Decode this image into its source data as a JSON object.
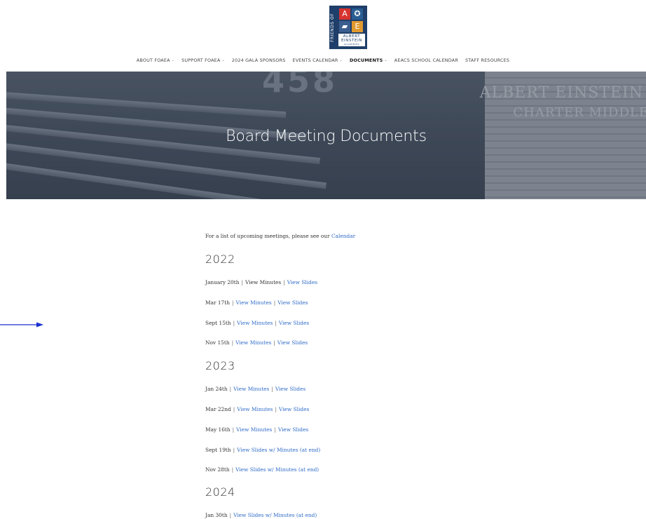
{
  "logo": {
    "side_text": "FRIENDS OF",
    "cell_a": "A",
    "cell_b": "✪",
    "cell_c": "▰",
    "cell_d": "E",
    "line1": "ALBERT",
    "line2": "EINSTEIN",
    "line3": "ACADEMIES",
    "colors": {
      "red": "#d7332f",
      "blue": "#2a5d92",
      "orange": "#e09a2d",
      "navy": "#1f3f6a"
    }
  },
  "nav": {
    "items": [
      {
        "label": "ABOUT FOAEA",
        "caret": "⌄",
        "active": false
      },
      {
        "label": "SUPPORT FOAEA",
        "caret": "⌄",
        "active": false
      },
      {
        "label": "2024 GALA SPONSORS",
        "caret": "",
        "active": false
      },
      {
        "label": "EVENTS CALENDAR",
        "caret": "⌄",
        "active": false
      },
      {
        "label": "DOCUMENTS",
        "caret": "⌄",
        "active": true
      },
      {
        "label": "AEACS SCHOOL CALENDAR",
        "caret": "",
        "active": false
      },
      {
        "label": "STAFF RESOURCES",
        "caret": "",
        "active": false
      }
    ]
  },
  "hero": {
    "title": "Board Meeting Documents",
    "building_number": "458",
    "sign_line1": "ALBERT EINSTEIN",
    "sign_line2": "CHARTER MIDDLE"
  },
  "content": {
    "intro_text": "For a list of upcoming meetings, please see our",
    "intro_link": "Calendar",
    "separator": "|",
    "sections": [
      {
        "year": "2022",
        "rows": [
          {
            "date": "January 20th",
            "minutes": "View Minutes",
            "minutes_is_link": false,
            "slides": "View Slides"
          },
          {
            "date": "Mar 17th",
            "minutes": "View Minutes",
            "minutes_is_link": true,
            "slides": "View Slides"
          },
          {
            "date": "Sept 15th",
            "minutes": "View Minutes",
            "minutes_is_link": true,
            "slides": "View Slides"
          },
          {
            "date": "Nov 15th",
            "minutes": "View Minutes",
            "minutes_is_link": true,
            "slides": "View Slides"
          }
        ]
      },
      {
        "year": "2023",
        "rows": [
          {
            "date": "Jan 24th",
            "minutes": "View Minutes",
            "minutes_is_link": true,
            "slides": "View Slides"
          },
          {
            "date": "Mar 22nd",
            "minutes": "View Minutes",
            "minutes_is_link": true,
            "slides": "View Slides"
          },
          {
            "date": "May 16th",
            "minutes": "View Minutes",
            "minutes_is_link": true,
            "slides": "View Slides"
          },
          {
            "date": "Sept 19th",
            "minutes": "",
            "minutes_is_link": false,
            "slides": "View Slides w/ Minutes (at end)"
          },
          {
            "date": "Nov 28th",
            "minutes": "",
            "minutes_is_link": false,
            "slides": "View Slides w/ Minutes (at end)"
          }
        ]
      },
      {
        "year": "2024",
        "rows": [
          {
            "date": "Jan 30th",
            "minutes": "",
            "minutes_is_link": false,
            "slides": "View Slides w/ Minutes (at end)"
          }
        ]
      }
    ]
  },
  "colors": {
    "link": "#2f6cc8",
    "arrow": "#1a2fd1",
    "text": "#333333"
  }
}
